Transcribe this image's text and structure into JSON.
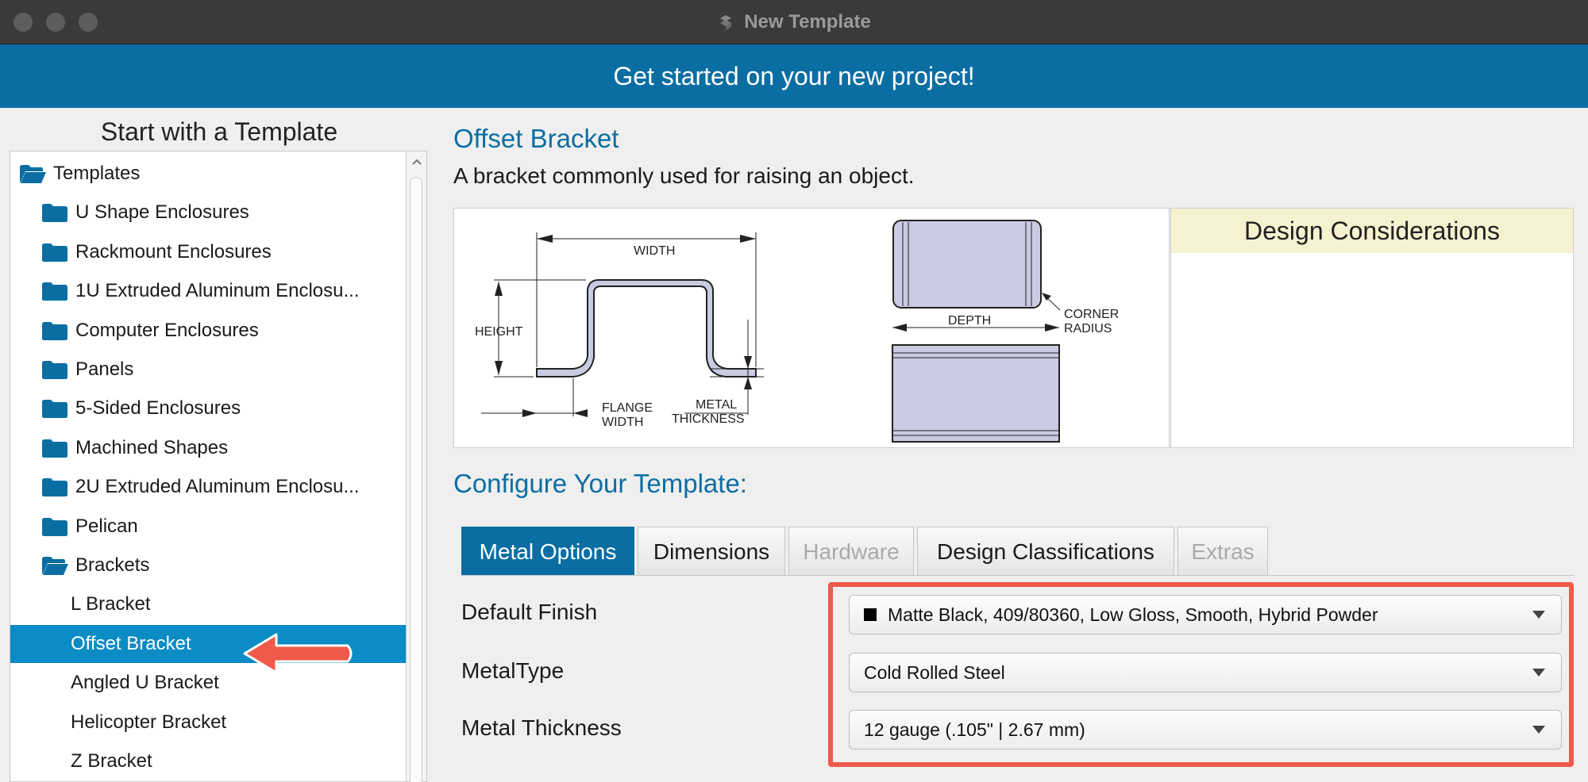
{
  "window": {
    "title": "New Template"
  },
  "banner": {
    "text": "Get started on your new project!"
  },
  "left_panel": {
    "heading": "Start with a Template",
    "tree": [
      {
        "label": "Templates",
        "type": "folder-open",
        "level": 0,
        "selected": false
      },
      {
        "label": "U Shape Enclosures",
        "type": "folder",
        "level": 1,
        "selected": false
      },
      {
        "label": "Rackmount Enclosures",
        "type": "folder",
        "level": 1,
        "selected": false
      },
      {
        "label": "1U Extruded Aluminum Enclosu...",
        "type": "folder",
        "level": 1,
        "selected": false
      },
      {
        "label": "Computer Enclosures",
        "type": "folder",
        "level": 1,
        "selected": false
      },
      {
        "label": "Panels",
        "type": "folder",
        "level": 1,
        "selected": false
      },
      {
        "label": "5-Sided Enclosures",
        "type": "folder",
        "level": 1,
        "selected": false
      },
      {
        "label": "Machined Shapes",
        "type": "folder",
        "level": 1,
        "selected": false
      },
      {
        "label": "2U Extruded Aluminum Enclosu...",
        "type": "folder",
        "level": 1,
        "selected": false
      },
      {
        "label": "Pelican",
        "type": "folder",
        "level": 1,
        "selected": false
      },
      {
        "label": "Brackets",
        "type": "folder-open",
        "level": 1,
        "selected": false
      },
      {
        "label": "L Bracket",
        "type": "item",
        "level": 2,
        "selected": false
      },
      {
        "label": "Offset Bracket",
        "type": "item",
        "level": 2,
        "selected": true
      },
      {
        "label": "Angled U Bracket",
        "type": "item",
        "level": 2,
        "selected": false
      },
      {
        "label": "Helicopter Bracket",
        "type": "item",
        "level": 2,
        "selected": false
      },
      {
        "label": "Z Bracket",
        "type": "item",
        "level": 2,
        "selected": false
      }
    ]
  },
  "template": {
    "title": "Offset Bracket",
    "description": "A bracket commonly used for raising an object.",
    "diagram_labels": {
      "width": "WIDTH",
      "height": "HEIGHT",
      "flange_width": [
        "FLANGE",
        "WIDTH"
      ],
      "metal_thickness": [
        "METAL",
        "THICKNESS"
      ],
      "depth": "DEPTH",
      "corner_radius": [
        "CORNER",
        "RADIUS"
      ]
    },
    "design_considerations_heading": "Design Considerations"
  },
  "configure": {
    "title": "Configure Your Template:",
    "tabs": [
      {
        "label": "Metal Options",
        "state": "active"
      },
      {
        "label": "Dimensions",
        "state": "normal"
      },
      {
        "label": "Hardware",
        "state": "disabled"
      },
      {
        "label": "Design Classifications",
        "state": "normal"
      },
      {
        "label": "Extras",
        "state": "disabled"
      }
    ],
    "fields": [
      {
        "label": "Default Finish",
        "value": "Matte Black, 409/80360, Low Gloss, Smooth, Hybrid Powder",
        "swatch": "#000000"
      },
      {
        "label": "MetalType",
        "value": "Cold Rolled Steel"
      },
      {
        "label": "Metal Thickness",
        "value": "12 gauge (.105\" | 2.67 mm)"
      }
    ]
  },
  "colors": {
    "accent": "#0b6ea3",
    "selection": "#0b8cc4",
    "highlight": "#ef5a4b",
    "title_bar": "#3a3a3a",
    "design_considerations_header": "#f6f1cf"
  }
}
